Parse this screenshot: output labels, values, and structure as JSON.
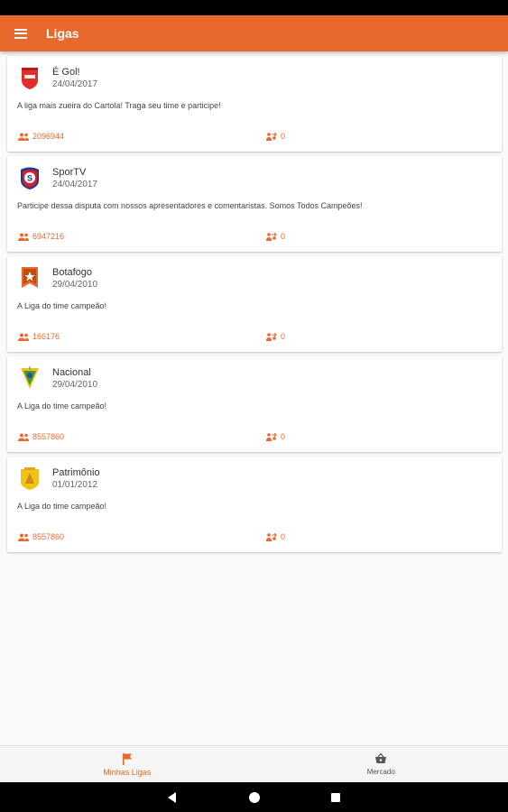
{
  "app_bar": {
    "title": "Ligas"
  },
  "leagues": [
    {
      "name": "É Gol!",
      "date": "24/04/2017",
      "description": "A liga mais zueira do Cartola! Traga seu time e participe!",
      "members": "2096944",
      "teams": "0",
      "crest": "egol-crest-icon"
    },
    {
      "name": "SporTV",
      "date": "24/04/2017",
      "description": "Participe dessa disputa com nossos apresentadores e comentaristas. Somos Todos Campeões!",
      "members": "6947216",
      "teams": "0",
      "crest": "sportv-crest-icon"
    },
    {
      "name": "Botafogo",
      "date": "29/04/2010",
      "description": "A Liga do time campeão!",
      "members": "166176",
      "teams": "0",
      "crest": "botafogo-crest-icon"
    },
    {
      "name": "Nacional",
      "date": "29/04/2010",
      "description": "A Liga do time campeão!",
      "members": "8557860",
      "teams": "0",
      "crest": "nacional-crest-icon"
    },
    {
      "name": "Patrimônio",
      "date": "01/01/2012",
      "description": "A Liga do time campeão!",
      "members": "8557860",
      "teams": "0",
      "crest": "patrimonio-crest-icon"
    }
  ],
  "bottom_nav": {
    "items": [
      {
        "label": "Minhas Ligas",
        "icon": "flag-icon",
        "active": true
      },
      {
        "label": "Mercado",
        "icon": "basket-icon",
        "active": false
      }
    ]
  },
  "colors": {
    "accent": "#e8692b",
    "status_bar": "#000000",
    "background": "#fafafa"
  }
}
